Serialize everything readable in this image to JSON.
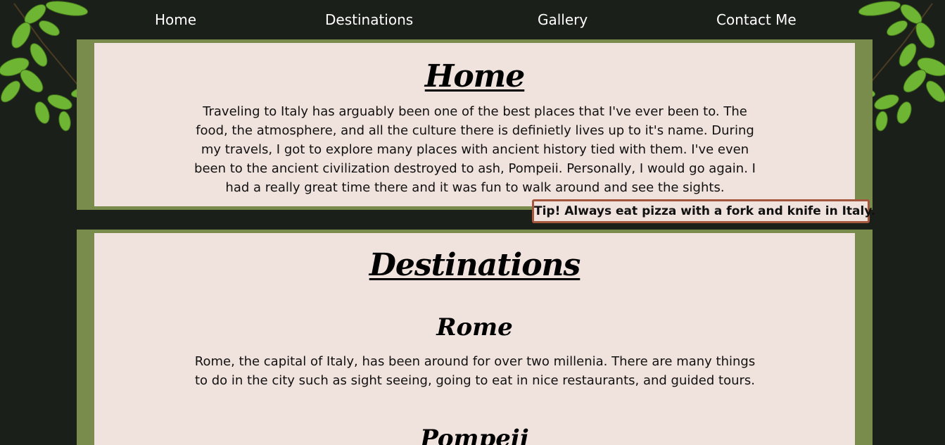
{
  "nav": {
    "home": "Home",
    "destinations": "Destinations",
    "gallery": "Gallery",
    "contact": "Contact Me"
  },
  "home": {
    "title": "Home",
    "text": "Traveling to Italy has arguably been one of the best places that I've ever been to. The food, the atmosphere, and all the culture there is definietly lives up to it's name. During my travels, I got to explore many places with ancient history tied with them. I've even been to the ancient civilization destroyed to ash, Pompeii. Personally, I would go again. I had a really great time there and it was fun to walk around and see the sights."
  },
  "tip": "Tip! Always eat pizza with a fork and knife in Italy.",
  "destinations": {
    "title": "Destinations",
    "rome": {
      "title": "Rome",
      "text": "Rome, the capital of Italy, has been around for over two millenia. There are many things to do in the city such as sight seeing, going to eat in nice restaurants, and guided tours."
    },
    "pompeii": {
      "title": "Pompeii"
    }
  },
  "colors": {
    "background": "#1b1f19",
    "section_border": "#7a8c4c",
    "panel": "#f0e2dc",
    "tip_border": "#a4573c",
    "leaf": "#6fb534"
  },
  "icons": {
    "left_decoration": "leaves-icon",
    "right_decoration": "leaves-icon"
  }
}
